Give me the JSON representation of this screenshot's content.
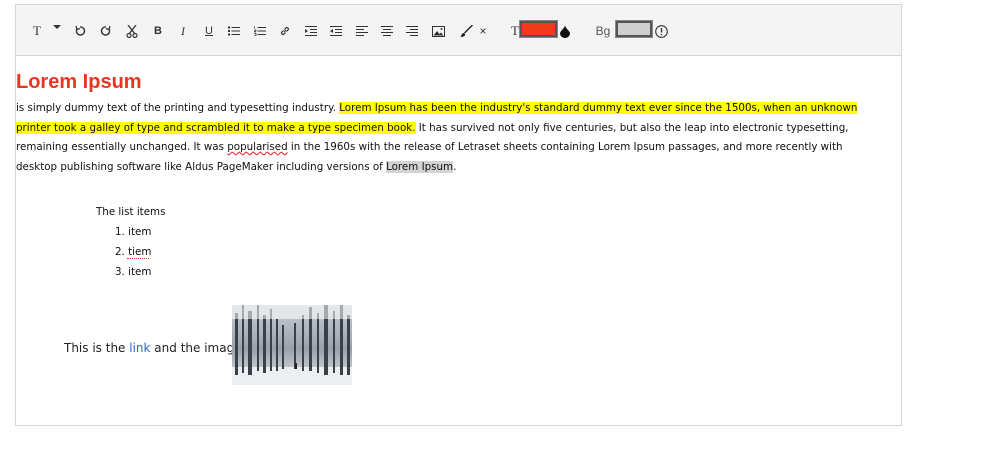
{
  "toolbar": {
    "heading_label": "T",
    "bold_label": "B",
    "italic_label": "I",
    "underline_label": "U",
    "clear_label": "×",
    "text_color_label": "T",
    "text_color": "#f03a1e",
    "bg_label": "Bg",
    "bg_color": "#cfcfcf",
    "icons": [
      "heading-icon",
      "dropdown-caret-icon",
      "undo-icon",
      "redo-icon",
      "cut-icon",
      "bold-icon",
      "italic-icon",
      "underline-icon",
      "unordered-list-icon",
      "ordered-list-icon",
      "link-icon",
      "indent-icon",
      "outdent-icon",
      "align-left-icon",
      "align-center-icon",
      "align-right-icon",
      "image-icon",
      "brush-icon",
      "clear-format-icon",
      "drop-icon",
      "info-icon"
    ]
  },
  "content": {
    "title": "Lorem Ipsum",
    "title_color": "#e8361f",
    "p1": "is simply dummy text of the printing and typesetting industry. ",
    "p_highlight": "Lorem Ipsum has been the industry's standard dummy text ever since the 1500s, when an unknown printer took a galley of type and scrambled it to make a type specimen book.",
    "p2": " It has survived not only five centuries, but also the leap into electronic typesetting, remaining essentially unchanged. It was ",
    "p_misspelled": "popularised",
    "p3": " in the 1960s with the release of Letraset sheets containing Lorem Ipsum passages, and more recently with desktop publishing software like Aldus PageMaker including versions of ",
    "p_gray": "Lorem Ipsum",
    "p4": ".",
    "highlight_color": "#ffff00",
    "list_title": "The list items",
    "list_items": [
      "1. item",
      "2. tiem",
      "3. item"
    ],
    "link_prefix": "This is the ",
    "link_text": "link",
    "link_suffix": " and the image"
  }
}
